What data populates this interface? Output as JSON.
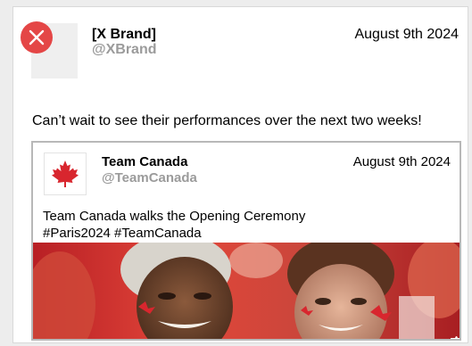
{
  "post": {
    "author_name": "[X Brand]",
    "author_handle": "@XBrand",
    "date": "August 9th 2024",
    "text": "Can’t wait to see their performances over the next two weeks!"
  },
  "quoted_post": {
    "author_name": "Team Canada",
    "author_handle": "@TeamCanada",
    "date": "August 9th 2024",
    "text_line1": "Team Canada walks the Opening Ceremony",
    "text_line2": "#Paris2024 #TeamCanada",
    "avatar_icon": "maple-leaf-icon",
    "media": {
      "alt": "",
      "action_icons": [
        "like-icon",
        "comment-icon",
        "share-icon"
      ]
    }
  },
  "colors": {
    "close_badge": "#e44646",
    "handle_gray": "#9b9b9b",
    "canada_red": "#d8262e"
  }
}
